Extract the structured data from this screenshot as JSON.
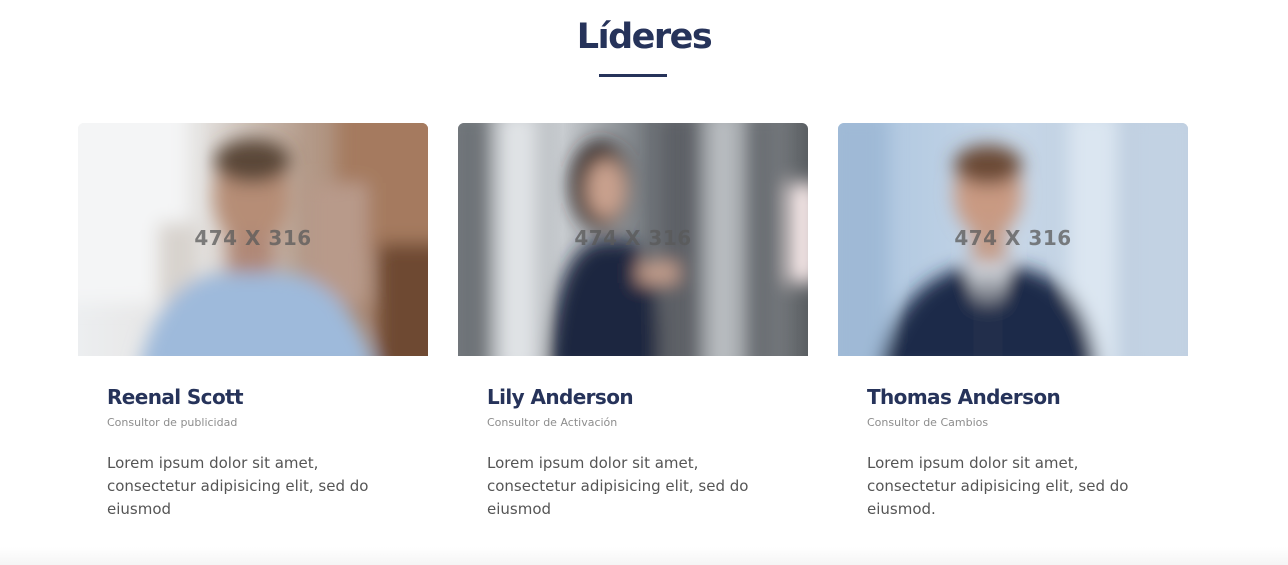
{
  "section": {
    "title": "Líderes"
  },
  "leaders": [
    {
      "name": "Reenal Scott",
      "role": "Consultor de publicidad",
      "description": "Lorem ipsum dolor sit amet, consectetur adipisicing elit, sed do eiusmod",
      "image_placeholder": "474 X 316"
    },
    {
      "name": "Lily Anderson",
      "role": "Consultor de Activación",
      "description": "Lorem ipsum dolor sit amet, consectetur adipisicing elit, sed do eiusmod",
      "image_placeholder": "474 X 316"
    },
    {
      "name": "Thomas Anderson",
      "role": "Consultor de Cambios",
      "description": "Lorem ipsum dolor sit amet, consectetur adipisicing elit, sed do eiusmod.",
      "image_placeholder": "474 X 316"
    }
  ],
  "colors": {
    "heading": "#26335a",
    "role_text": "#8d8d8d",
    "body_text": "#555555"
  }
}
